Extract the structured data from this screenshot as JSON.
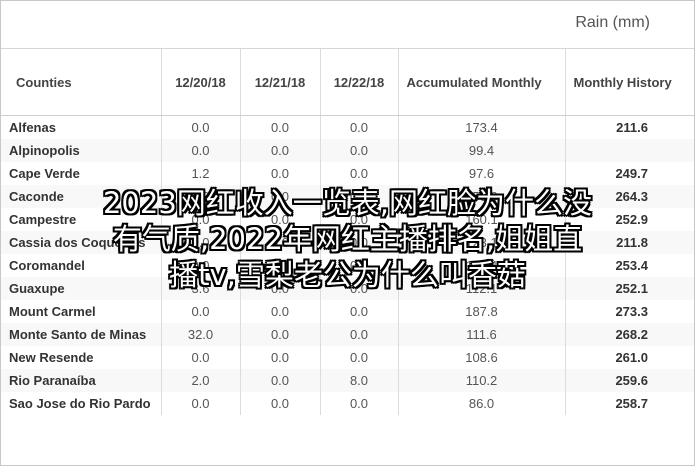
{
  "unit_label": "Rain (mm)",
  "columns": [
    "Counties",
    "12/20/18",
    "12/21/18",
    "12/22/18",
    "Accumulated Monthly",
    "Monthly History"
  ],
  "rows": [
    {
      "county": "Alfenas",
      "d1": "0.0",
      "d2": "0.0",
      "d3": "0.0",
      "accumulated": "173.4",
      "history": "211.6"
    },
    {
      "county": "Alpinopolis",
      "d1": "0.0",
      "d2": "0.0",
      "d3": "0.0",
      "accumulated": "99.4",
      "history": ""
    },
    {
      "county": "Cape Verde",
      "d1": "1.2",
      "d2": "0.0",
      "d3": "0.0",
      "accumulated": "97.6",
      "history": "249.7"
    },
    {
      "county": "Caconde",
      "d1": "0.0",
      "d2": "0.0",
      "d3": "0.0",
      "accumulated": "150.0",
      "history": "264.3"
    },
    {
      "county": "Campestre",
      "d1": "0.0",
      "d2": "0.0",
      "d3": "0.0",
      "accumulated": "160.1",
      "history": "252.9"
    },
    {
      "county": "Cassia dos Coqueiros",
      "d1": "0.0",
      "d2": "0.0",
      "d3": "0.0",
      "accumulated": "123.1",
      "history": "211.8"
    },
    {
      "county": "Coromandel",
      "d1": "0.0",
      "d2": "0.0",
      "d3": "0.0",
      "accumulated": "112.4",
      "history": "253.4"
    },
    {
      "county": "Guaxupe",
      "d1": "3.6",
      "d2": "0.0",
      "d3": "0.0",
      "accumulated": "112.1",
      "history": "252.1"
    },
    {
      "county": "Mount Carmel",
      "d1": "0.0",
      "d2": "0.0",
      "d3": "0.0",
      "accumulated": "187.8",
      "history": "273.3"
    },
    {
      "county": "Monte Santo de Minas",
      "d1": "32.0",
      "d2": "0.0",
      "d3": "0.0",
      "accumulated": "111.6",
      "history": "268.2"
    },
    {
      "county": "New Resende",
      "d1": "0.0",
      "d2": "0.0",
      "d3": "0.0",
      "accumulated": "108.6",
      "history": "261.0"
    },
    {
      "county": "Rio Paranaíba",
      "d1": "2.0",
      "d2": "0.0",
      "d3": "8.0",
      "accumulated": "110.2",
      "history": "259.6"
    },
    {
      "county": "Sao Jose do Rio Pardo",
      "d1": "0.0",
      "d2": "0.0",
      "d3": "0.0",
      "accumulated": "86.0",
      "history": "258.7"
    }
  ],
  "overlay_lines": [
    "2023网红收入一览表,网红脸为什么没",
    "有气质,2022年网红主播排名,姐姐直",
    "播tv,雪梨老公为什么叫香菇"
  ]
}
